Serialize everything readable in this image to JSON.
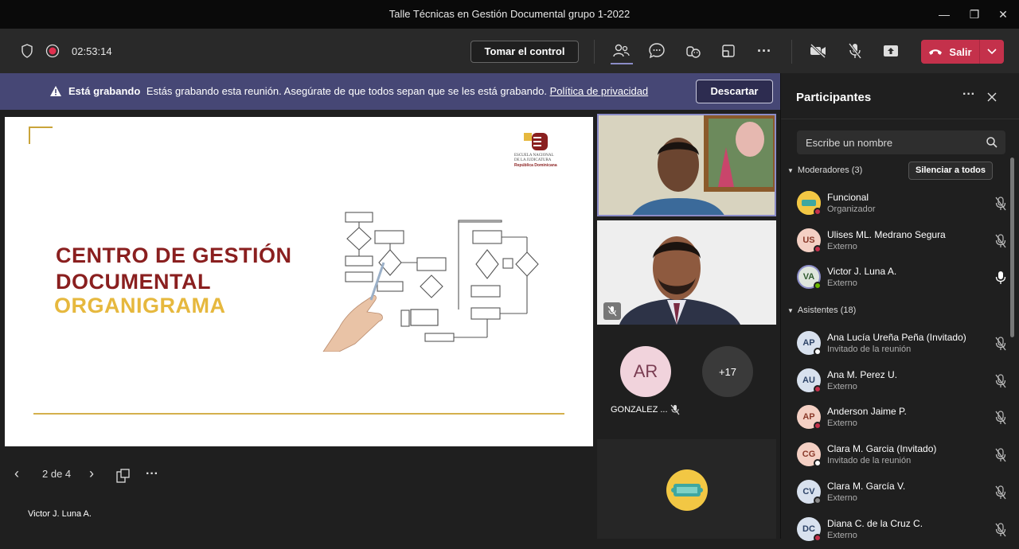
{
  "window": {
    "title": "Talle Técnicas en Gestión Documental grupo 1-2022"
  },
  "toolbar": {
    "timer": "02:53:14",
    "take_control": "Tomar el control",
    "leave": "Salir",
    "icons": [
      "shield-icon",
      "record-icon",
      "people-icon",
      "chat-icon",
      "reactions-icon",
      "rooms-icon",
      "more-icon",
      "camera-off-icon",
      "mic-off-icon",
      "share-icon",
      "phone-icon"
    ],
    "colors": {
      "leave": "#c4314b",
      "banner": "#464775"
    }
  },
  "banner": {
    "strong": "Está grabando",
    "message": "Estás grabando esta reunión. Asegúrate de que todos sepan que se les está grabando.",
    "link": "Política de privacidad",
    "dismiss": "Descartar"
  },
  "slide": {
    "title_line1": "CENTRO DE GESTIÓN",
    "title_line2": "DOCUMENTAL",
    "subtitle": "ORGANIGRAMA",
    "logo_line1": "ESCUELA NACIONAL",
    "logo_line2": "DE LA JUDICATURA",
    "logo_line3": "República Dominicana",
    "colors": {
      "title": "#8a1f1f",
      "subtitle": "#e6b83e"
    }
  },
  "presentation": {
    "page": "2 de 4",
    "presenter": "Victor J. Luna A."
  },
  "tiles": {
    "ar_initials": "AR",
    "ar_name": "GONZALEZ ...",
    "more_count": "+17"
  },
  "participants": {
    "title": "Participantes",
    "search_placeholder": "Escribe un nombre",
    "moderators_label": "Moderadores (3)",
    "mute_all": "Silenciar a todos",
    "attendees_label": "Asistentes (18)",
    "moderators": [
      {
        "initials": "",
        "name": "Funcional",
        "role": "Organizador",
        "status": "#c4314b",
        "mic": "muted"
      },
      {
        "initials": "US",
        "name": "Ulises ML. Medrano Segura",
        "role": "Externo",
        "status": "#c4314b",
        "mic": "muted"
      },
      {
        "initials": "VA",
        "name": "Victor J. Luna A.",
        "role": "Externo",
        "status": "#6bb700",
        "mic": "on"
      }
    ],
    "attendees": [
      {
        "initials": "AP",
        "name": "Ana Lucía Ureña Peña (Invitado)",
        "role": "Invitado de la reunión",
        "status": "#ffffff",
        "mic": "muted"
      },
      {
        "initials": "AU",
        "name": "Ana M. Perez U.",
        "role": "Externo",
        "status": "#c4314b",
        "mic": "muted"
      },
      {
        "initials": "AP",
        "name": "Anderson Jaime P.",
        "role": "Externo",
        "status": "#c4314b",
        "mic": "muted"
      },
      {
        "initials": "CG",
        "name": "Clara M. Garcia (Invitado)",
        "role": "Invitado de la reunión",
        "status": "#ffffff",
        "mic": "muted"
      },
      {
        "initials": "CV",
        "name": "Clara M. García V.",
        "role": "Externo",
        "status": "#8a8a8a",
        "mic": "muted"
      },
      {
        "initials": "DC",
        "name": "Diana C. de la Cruz C.",
        "role": "Externo",
        "status": "#c4314b",
        "mic": "muted"
      }
    ]
  }
}
